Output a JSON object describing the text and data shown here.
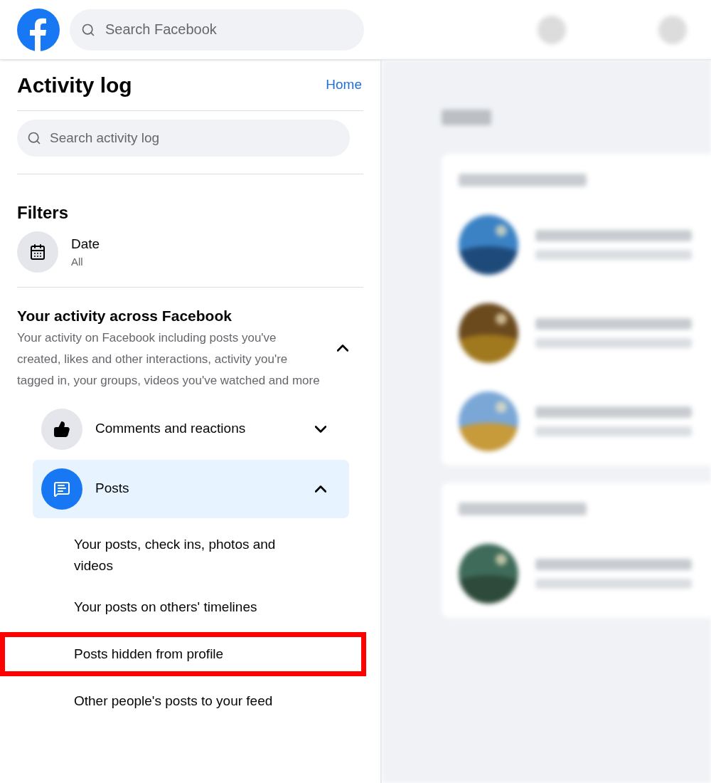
{
  "header": {
    "search": {
      "placeholder": "Search Facebook"
    }
  },
  "sidebar": {
    "title": "Activity log",
    "home_link": "Home",
    "search": {
      "placeholder": "Search activity log"
    },
    "filters_heading": "Filters",
    "filters": [
      {
        "label": "Date",
        "value": "All"
      }
    ],
    "section": {
      "title": "Your activity across Facebook",
      "description": "Your activity on Facebook including posts you've created, likes and other interactions, activity you're tagged in, your groups, videos you've watched and more",
      "expanded": true,
      "categories": [
        {
          "kind": "reactions",
          "label": "Comments and reactions",
          "expanded": false,
          "selected": false
        },
        {
          "kind": "posts",
          "label": "Posts",
          "expanded": true,
          "selected": true,
          "children": [
            {
              "label": "Your posts, check ins, photos and videos",
              "highlighted": false
            },
            {
              "label": "Your posts on others' timelines",
              "highlighted": false
            },
            {
              "label": "Posts hidden from profile",
              "highlighted": true
            },
            {
              "label": "Other people's posts to your feed",
              "highlighted": false
            }
          ]
        }
      ]
    }
  }
}
